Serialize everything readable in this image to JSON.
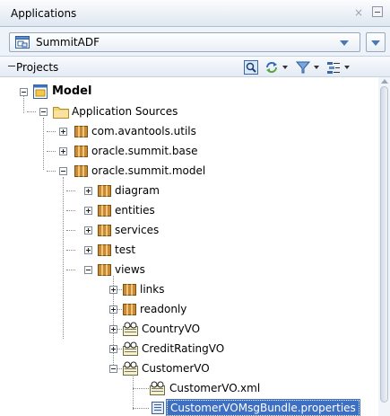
{
  "panel": {
    "title": "Applications"
  },
  "app_selector": {
    "selected": "SummitADF"
  },
  "projects_bar": {
    "label": "Projects"
  },
  "tree": {
    "nodes": [
      {
        "label": "Model"
      },
      {
        "label": "Application Sources"
      },
      {
        "label": "com.avantools.utils"
      },
      {
        "label": "oracle.summit.base"
      },
      {
        "label": "oracle.summit.model"
      },
      {
        "label": "diagram"
      },
      {
        "label": "entities"
      },
      {
        "label": "services"
      },
      {
        "label": "test"
      },
      {
        "label": "views"
      },
      {
        "label": "links"
      },
      {
        "label": "readonly"
      },
      {
        "label": "CountryVO"
      },
      {
        "label": "CreditRatingVO"
      },
      {
        "label": "CustomerVO"
      },
      {
        "label": "CustomerVO.xml"
      },
      {
        "label": "CustomerVOMsgBundle.properties"
      }
    ]
  }
}
